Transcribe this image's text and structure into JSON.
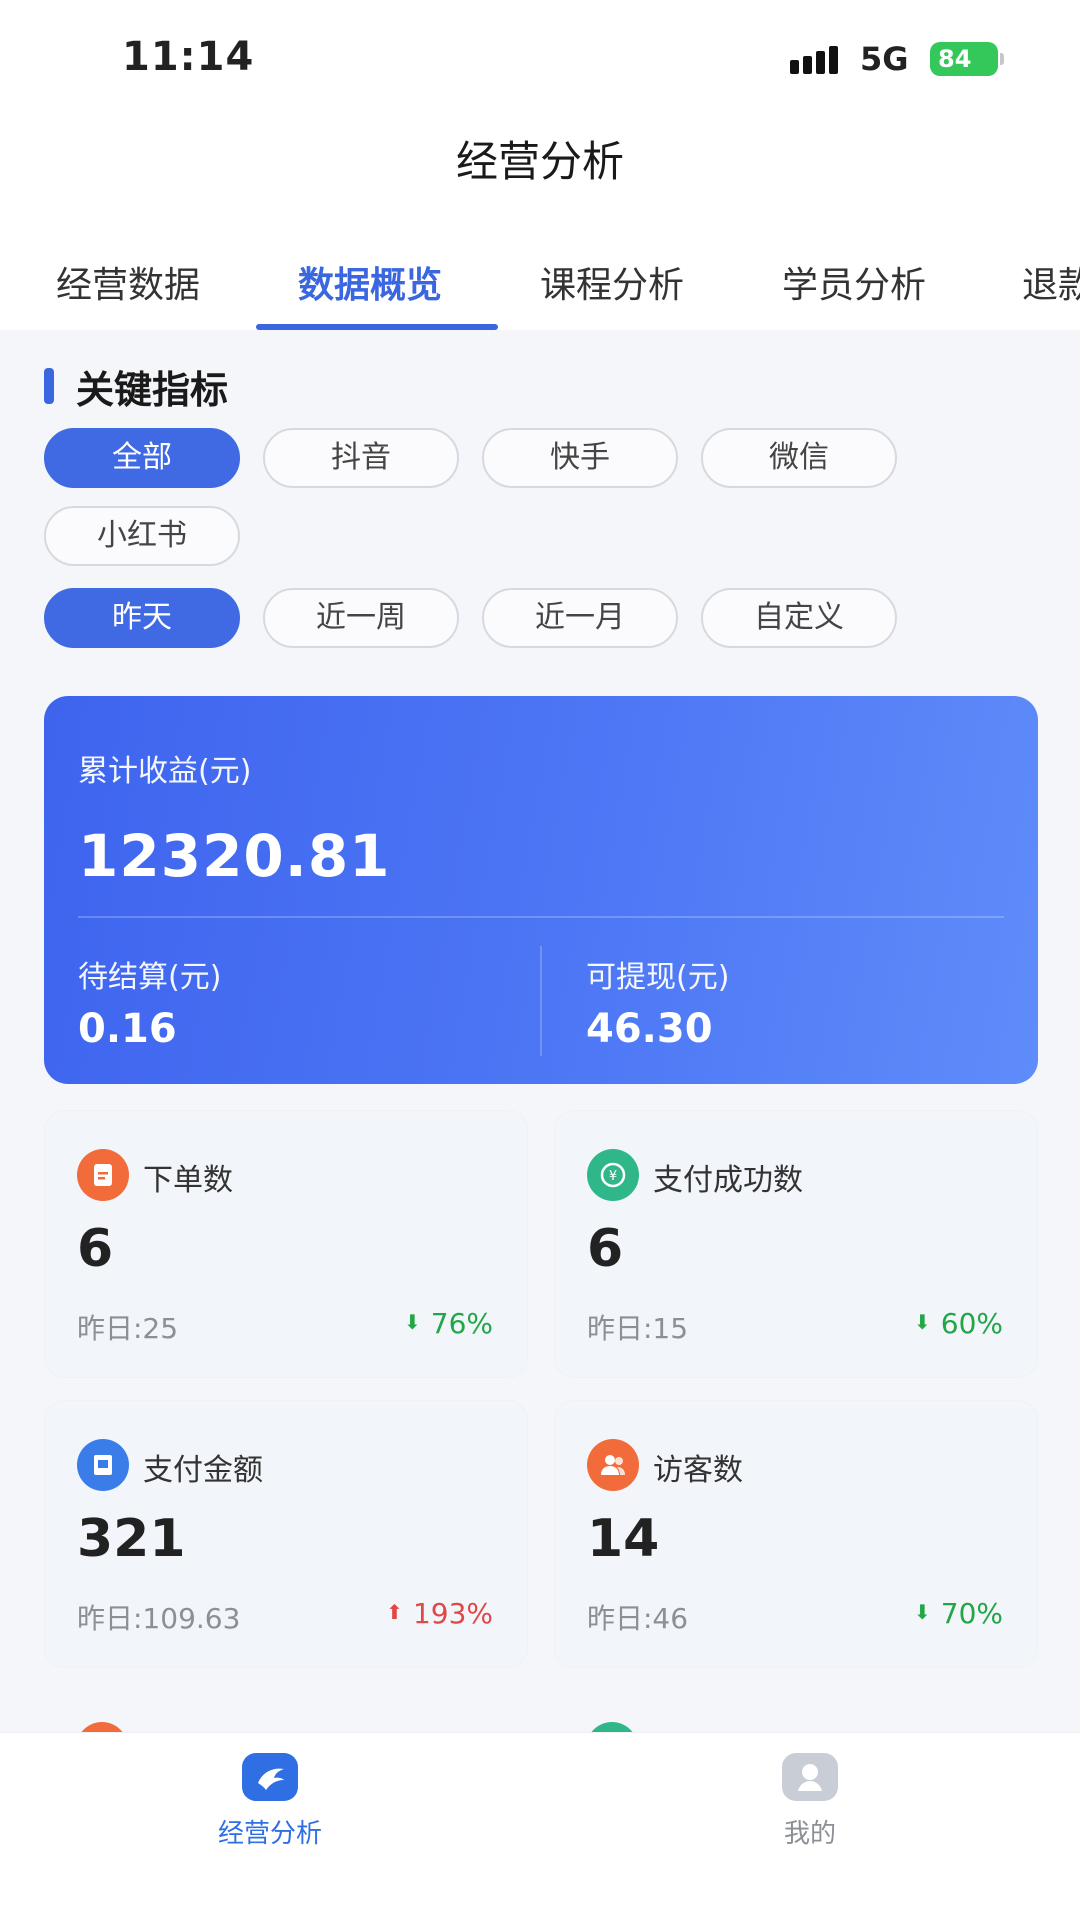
{
  "status_bar": {
    "time": "11:14",
    "network": "5G",
    "battery": "84"
  },
  "nav": {
    "title": "经营分析"
  },
  "tabs": [
    {
      "label": "经营数据",
      "active": false
    },
    {
      "label": "数据概览",
      "active": true
    },
    {
      "label": "课程分析",
      "active": false
    },
    {
      "label": "学员分析",
      "active": false
    },
    {
      "label": "退款",
      "active": false
    }
  ],
  "section": {
    "title": "关键指标"
  },
  "platform_filters": [
    {
      "label": "全部",
      "active": true
    },
    {
      "label": "抖音",
      "active": false
    },
    {
      "label": "快手",
      "active": false
    },
    {
      "label": "微信",
      "active": false
    },
    {
      "label": "小红书",
      "active": false
    }
  ],
  "period_filters": [
    {
      "label": "昨天",
      "active": true
    },
    {
      "label": "近一周",
      "active": false
    },
    {
      "label": "近一月",
      "active": false
    },
    {
      "label": "自定义",
      "active": false
    }
  ],
  "earnings": {
    "total_label": "累计收益(元)",
    "total_value": "12320.81",
    "pending_label": "待结算(元)",
    "pending_value": "0.16",
    "withdrawable_label": "可提现(元)",
    "withdrawable_value": "46.30"
  },
  "metrics": [
    {
      "title": "下单数",
      "value": "6",
      "yesterday": "昨日:25",
      "change": "76%",
      "direction": "down",
      "icon": "order-icon",
      "color": "#f26b3a"
    },
    {
      "title": "支付成功数",
      "value": "6",
      "yesterday": "昨日:15",
      "change": "60%",
      "direction": "down",
      "icon": "payment-success-icon",
      "color": "#2fb78a"
    },
    {
      "title": "支付金额",
      "value": "321",
      "yesterday": "昨日:109.63",
      "change": "193%",
      "direction": "up",
      "icon": "payment-amount-icon",
      "color": "#3b7de8"
    },
    {
      "title": "访客数",
      "value": "14",
      "yesterday": "昨日:46",
      "change": "70%",
      "direction": "down",
      "icon": "visitors-icon",
      "color": "#f26b3a"
    }
  ],
  "bottom_nav": [
    {
      "label": "经营分析",
      "active": true,
      "icon": "business-analysis-icon"
    },
    {
      "label": "我的",
      "active": false,
      "icon": "profile-icon"
    }
  ],
  "colors": {
    "primary": "#3a66e0",
    "down": "#22a647",
    "up": "#e04848"
  }
}
